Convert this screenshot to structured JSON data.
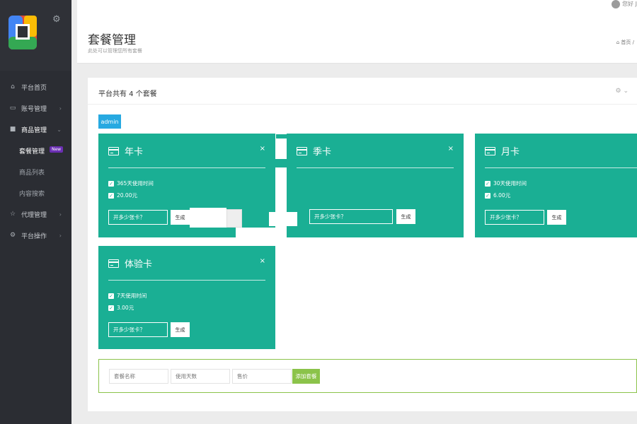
{
  "header": {
    "title": "套餐管理",
    "subtitle": "此处可以管理您所有套餐",
    "breadcrumb": "首页 /"
  },
  "topbar": {
    "user_text": "您好 J"
  },
  "sidebar": {
    "items": [
      {
        "label": "平台首页",
        "icon": "home-icon"
      },
      {
        "label": "账号管理",
        "icon": "monitor-icon"
      },
      {
        "label": "商品管理",
        "icon": "list-icon"
      },
      {
        "label": "代理管理",
        "icon": "star-icon"
      },
      {
        "label": "平台操作",
        "icon": "cog-icon"
      }
    ],
    "subitems": [
      {
        "label": "套餐管理",
        "badge": "New"
      },
      {
        "label": "商品列表"
      },
      {
        "label": "内容搜索"
      }
    ]
  },
  "panel": {
    "title": "平台共有 4 个套餐",
    "owner_tag": "admin"
  },
  "cards": [
    {
      "title": "年卡",
      "features": [
        "365天使用时间",
        "20.00元"
      ],
      "placeholder": "开多少张卡？",
      "button": "生成",
      "close": "×"
    },
    {
      "title": "季卡",
      "features": [],
      "placeholder": "开多少张卡？",
      "button": "生成",
      "close": "×"
    },
    {
      "title": "月卡",
      "features": [
        "30天使用时间",
        "6.00元"
      ],
      "placeholder": "开多少张卡？",
      "button": "生成",
      "close": "×"
    },
    {
      "title": "体验卡",
      "features": [
        "7天使用时间",
        "3.00元"
      ],
      "placeholder": "开多少张卡？",
      "button": "生成",
      "close": "×"
    }
  ],
  "add_form": {
    "name_placeholder": "套餐名称",
    "days_placeholder": "使用天数",
    "price_placeholder": "售价",
    "submit": "添加套餐"
  },
  "colors": {
    "sidebar": "#2b2d33",
    "card": "#1aaf94",
    "admin_tag": "#27a9e1",
    "add_button": "#8bc34a",
    "badge": "#6b2fb3"
  }
}
